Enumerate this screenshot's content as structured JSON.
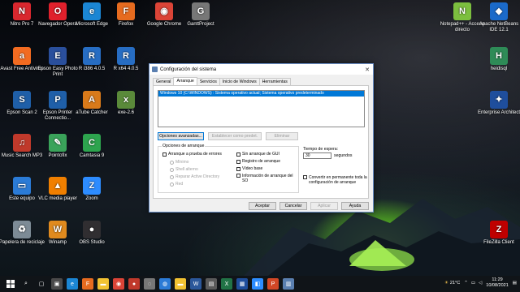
{
  "desktop": {
    "icons_left": [
      {
        "label": "Nitro Pro 7",
        "icon": "nitro-icon",
        "color": "#d9272e",
        "glyph": "N"
      },
      {
        "label": "Navegador Opera",
        "icon": "opera-icon",
        "color": "#e0202c",
        "glyph": "O"
      },
      {
        "label": "Microsoft Edge",
        "icon": "edge-icon",
        "color": "#1b86d4",
        "glyph": "e"
      },
      {
        "label": "Firefox",
        "icon": "firefox-icon",
        "color": "#e66b1f",
        "glyph": "F"
      },
      {
        "label": "Google Chrome",
        "icon": "chrome-icon",
        "color": "#db4437",
        "glyph": "◉"
      },
      {
        "label": "GanttProject",
        "icon": "ganttproject-icon",
        "color": "#777777",
        "glyph": "G"
      },
      {
        "label": "Avast Free Antivirus",
        "icon": "avast-icon",
        "color": "#f26b21",
        "glyph": "a"
      },
      {
        "label": "Epson Easy Photo Print",
        "icon": "epson-photo-icon",
        "color": "#2a4f9c",
        "glyph": "E"
      },
      {
        "label": "R i386 4.0.5",
        "icon": "r-icon",
        "color": "#276dc3",
        "glyph": "R"
      },
      {
        "label": "R x64 4.0.5",
        "icon": "r-icon",
        "color": "#276dc3",
        "glyph": "R"
      },
      {
        "label": "Epson Scan 2",
        "icon": "epson-scan-icon",
        "color": "#1f5fa8",
        "glyph": "S"
      },
      {
        "label": "Epson Printer Connectio...",
        "icon": "epson-printer-icon",
        "color": "#1f5fa8",
        "glyph": "P"
      },
      {
        "label": "aTube Catcher",
        "icon": "atube-icon",
        "color": "#d97a1a",
        "glyph": "A"
      },
      {
        "label": "exe-2.6",
        "icon": "exe-icon",
        "color": "#5a8a3a",
        "glyph": "x"
      },
      {
        "label": "Music Search MP3",
        "icon": "music-search-icon",
        "color": "#c0392b",
        "glyph": "♫"
      },
      {
        "label": "Pointofix",
        "icon": "pointofix-icon",
        "color": "#3aa35a",
        "glyph": "✎"
      },
      {
        "label": "Camtasia 9",
        "icon": "camtasia-icon",
        "color": "#2da44e",
        "glyph": "C"
      },
      {
        "label": "Este equipo",
        "icon": "computer-icon",
        "color": "#2b7bd6",
        "glyph": "▭"
      },
      {
        "label": "VLC media player",
        "icon": "vlc-icon",
        "color": "#f07f00",
        "glyph": "▲"
      },
      {
        "label": "Zoom",
        "icon": "zoom-icon",
        "color": "#2d8cff",
        "glyph": "Z"
      },
      {
        "label": "Papelera de reciclaje",
        "icon": "recycle-bin-icon",
        "color": "#7d8b96",
        "glyph": "♻"
      },
      {
        "label": "Winamp",
        "icon": "winamp-icon",
        "color": "#e08a1e",
        "glyph": "W"
      },
      {
        "label": "OBS Studio",
        "icon": "obs-icon",
        "color": "#302e31",
        "glyph": "●"
      }
    ],
    "icons_right": [
      {
        "label": "Notepad++ - Acceso directo",
        "icon": "notepadpp-icon",
        "color": "#7cbf3f",
        "glyph": "N"
      },
      {
        "label": "Apache NetBeans IDE 12.1",
        "icon": "netbeans-icon",
        "color": "#1b6ac9",
        "glyph": "◆"
      },
      {
        "label": "heidisql",
        "icon": "heidisql-icon",
        "color": "#2e8b57",
        "glyph": "H"
      },
      {
        "label": "Enterprise Architect",
        "icon": "enterprise-architect-icon",
        "color": "#1f4e9c",
        "glyph": "✦"
      },
      {
        "label": "FileZilla Client",
        "icon": "filezilla-icon",
        "color": "#bf0000",
        "glyph": "Z"
      }
    ]
  },
  "dialog": {
    "title": "Configuración del sistema",
    "tabs": [
      "General",
      "Arranque",
      "Servicios",
      "Inicio de Windows",
      "Herramientas"
    ],
    "active_tab": "Arranque",
    "os_list": [
      "Windows 10 (C:\\WINDOWS) : Sistema operativo actual; Sistema operativo predeterminado"
    ],
    "buttons": {
      "advanced": "Opciones avanzadas...",
      "set_default": "Establecer como predet.",
      "delete": "Eliminar"
    },
    "boot_options": {
      "legend": "Opciones de arranque",
      "safe_boot": "Arranque a prueba de errores",
      "minimal": "Mínimo",
      "alternate_shell": "Shell alterno",
      "ad_repair": "Reparar Active Directory",
      "network": "Red",
      "no_gui": "Sin arranque de GUI",
      "boot_log": "Registro de arranque",
      "base_video": "Vídeo base",
      "os_boot_info": "Información de arranque del SO"
    },
    "timeout": {
      "label": "Tiempo de espera:",
      "value": "30",
      "unit": "segundos"
    },
    "permanent": "Convertir en permanente toda la configuración de arranque",
    "footer": {
      "ok": "Aceptar",
      "cancel": "Cancelar",
      "apply": "Aplicar",
      "help": "Ayuda"
    }
  },
  "taskbar": {
    "temperature": "21°C",
    "time": "11:29",
    "date": "10/08/2021"
  }
}
